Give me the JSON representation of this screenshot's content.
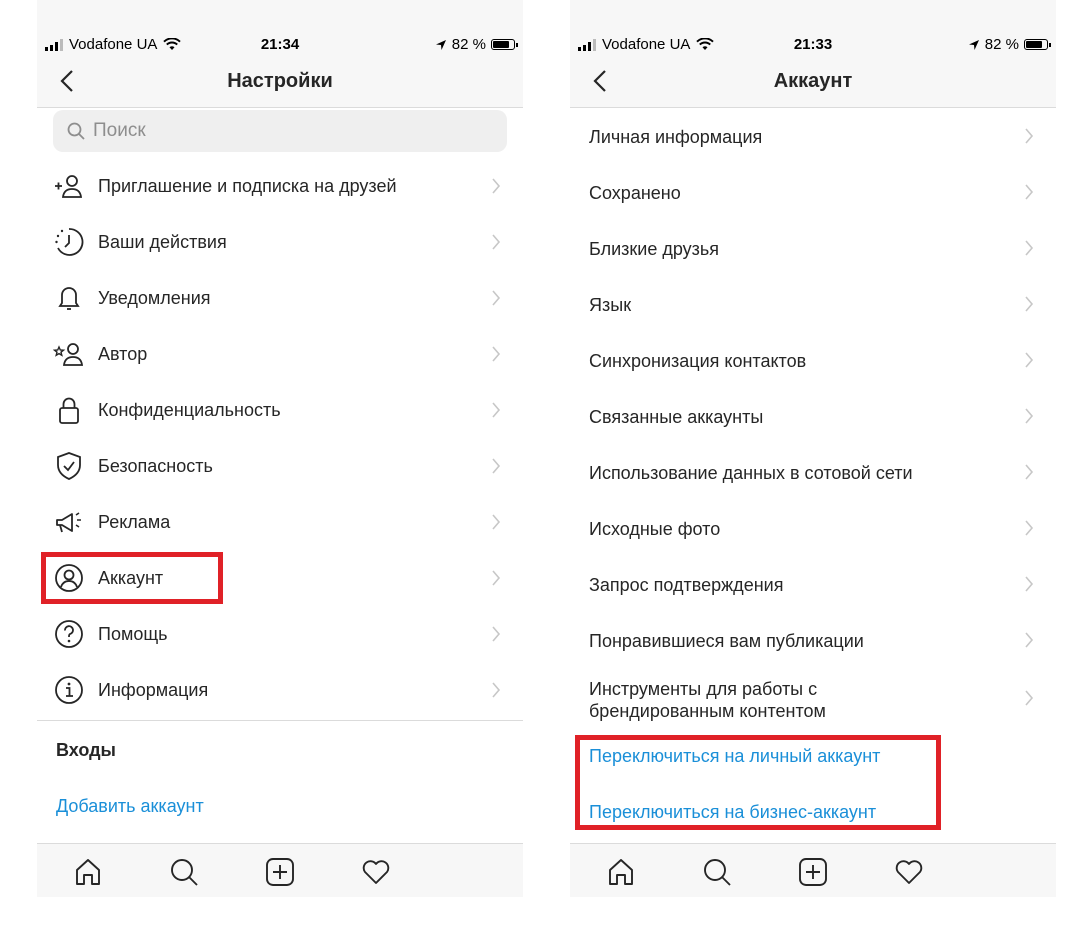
{
  "left_screen": {
    "status": {
      "carrier": "Vodafone UA",
      "time": "21:34",
      "battery": "82 %"
    },
    "nav": {
      "title": "Настройки"
    },
    "search": {
      "placeholder": "Поиск"
    },
    "items": [
      {
        "label": "Приглашение и подписка на друзей",
        "icon": "add-person-icon"
      },
      {
        "label": "Ваши действия",
        "icon": "activity-clock-icon"
      },
      {
        "label": "Уведомления",
        "icon": "bell-icon"
      },
      {
        "label": "Автор",
        "icon": "creator-star-person-icon"
      },
      {
        "label": "Конфиденциальность",
        "icon": "lock-icon"
      },
      {
        "label": "Безопасность",
        "icon": "shield-check-icon"
      },
      {
        "label": "Реклама",
        "icon": "megaphone-icon"
      },
      {
        "label": "Аккаунт",
        "icon": "account-circle-icon"
      },
      {
        "label": "Помощь",
        "icon": "help-circle-icon"
      },
      {
        "label": "Информация",
        "icon": "info-circle-icon"
      }
    ],
    "logins": {
      "title": "Входы",
      "add_account": "Добавить аккаунт"
    }
  },
  "right_screen": {
    "status": {
      "carrier": "Vodafone UA",
      "time": "21:33",
      "battery": "82 %"
    },
    "nav": {
      "title": "Аккаунт"
    },
    "items": [
      {
        "label": "Личная информация"
      },
      {
        "label": "Сохранено"
      },
      {
        "label": "Близкие друзья"
      },
      {
        "label": "Язык"
      },
      {
        "label": "Синхронизация контактов"
      },
      {
        "label": "Связанные аккаунты"
      },
      {
        "label": "Использование данных в сотовой сети"
      },
      {
        "label": "Исходные фото"
      },
      {
        "label": "Запрос подтверждения"
      },
      {
        "label": "Понравившиеся вам публикации"
      },
      {
        "label": "Инструменты для работы с брендированным контентом",
        "line1": "Инструменты для работы с",
        "line2": "брендированным контентом"
      }
    ],
    "links": {
      "personal": "Переключиться на личный аккаунт",
      "business": "Переключиться на бизнес-аккаунт"
    }
  },
  "tabbar_icons": [
    "home-icon",
    "search-icon",
    "new-post-icon",
    "activity-heart-icon"
  ],
  "colors": {
    "highlight": "#e02127",
    "link": "#1a8fd8",
    "text": "#262626",
    "chevron": "#c7c7c7",
    "bar_bg": "#f7f7f7"
  }
}
